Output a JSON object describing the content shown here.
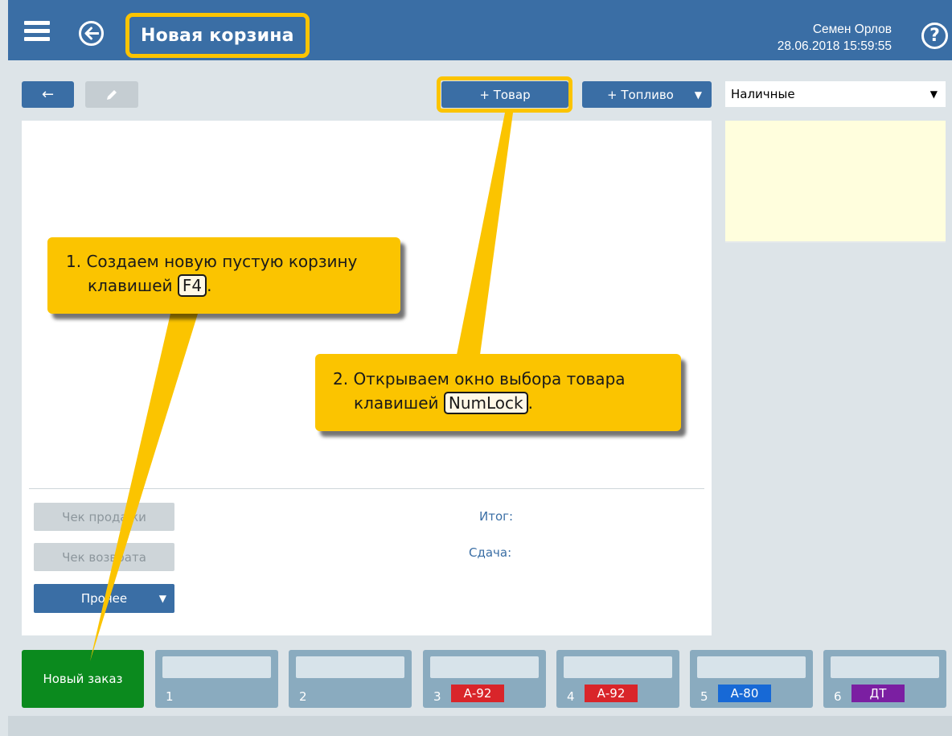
{
  "header": {
    "title": "Новая корзина",
    "user_name": "Семен Орлов",
    "datetime": "28.06.2018 15:59:55",
    "help_symbol": "?",
    "icons": [
      "hamburger-menu-icon",
      "back-circle-icon",
      "help-icon"
    ]
  },
  "toolbar": {
    "back_arrow": "←",
    "add_item_label": "+ Товар",
    "add_fuel_label": "+ Топливо",
    "add_fuel_caret": "▼",
    "payment_value": "Наличные",
    "payment_caret": "▼"
  },
  "actions": {
    "sale_receipt": "Чек продажи",
    "return_receipt": "Чек возврата",
    "other_label": "Прочее",
    "other_caret": "▼"
  },
  "totals": {
    "total_label": "Итог:",
    "change_label": "Сдача:"
  },
  "orders": {
    "new_order_label": "Новый заказ",
    "tiles": [
      {
        "number": "1",
        "fuel": ""
      },
      {
        "number": "2",
        "fuel": ""
      },
      {
        "number": "3",
        "fuel": "А-92",
        "fuel_color": "#d9252a"
      },
      {
        "number": "4",
        "fuel": "А-92",
        "fuel_color": "#d9252a"
      },
      {
        "number": "5",
        "fuel": "А-80",
        "fuel_color": "#1769d6"
      },
      {
        "number": "6",
        "fuel": "ДТ",
        "fuel_color": "#7b1fa2"
      }
    ]
  },
  "callouts": {
    "step1_prefix": "1. Создаем новую пустую корзину",
    "step1_key_prefix": "клавишей",
    "step1_key": "F4",
    "step1_suffix": ".",
    "step2_prefix": "2. Открываем окно выбора товара",
    "step2_key_prefix": "клавишей",
    "step2_key": "NumLock",
    "step2_suffix": "."
  },
  "colors": {
    "header_bg": "#3a6ea5",
    "highlight": "#fbc400",
    "new_order_bg": "#0b8a1e",
    "note_bg": "#fffedd"
  }
}
